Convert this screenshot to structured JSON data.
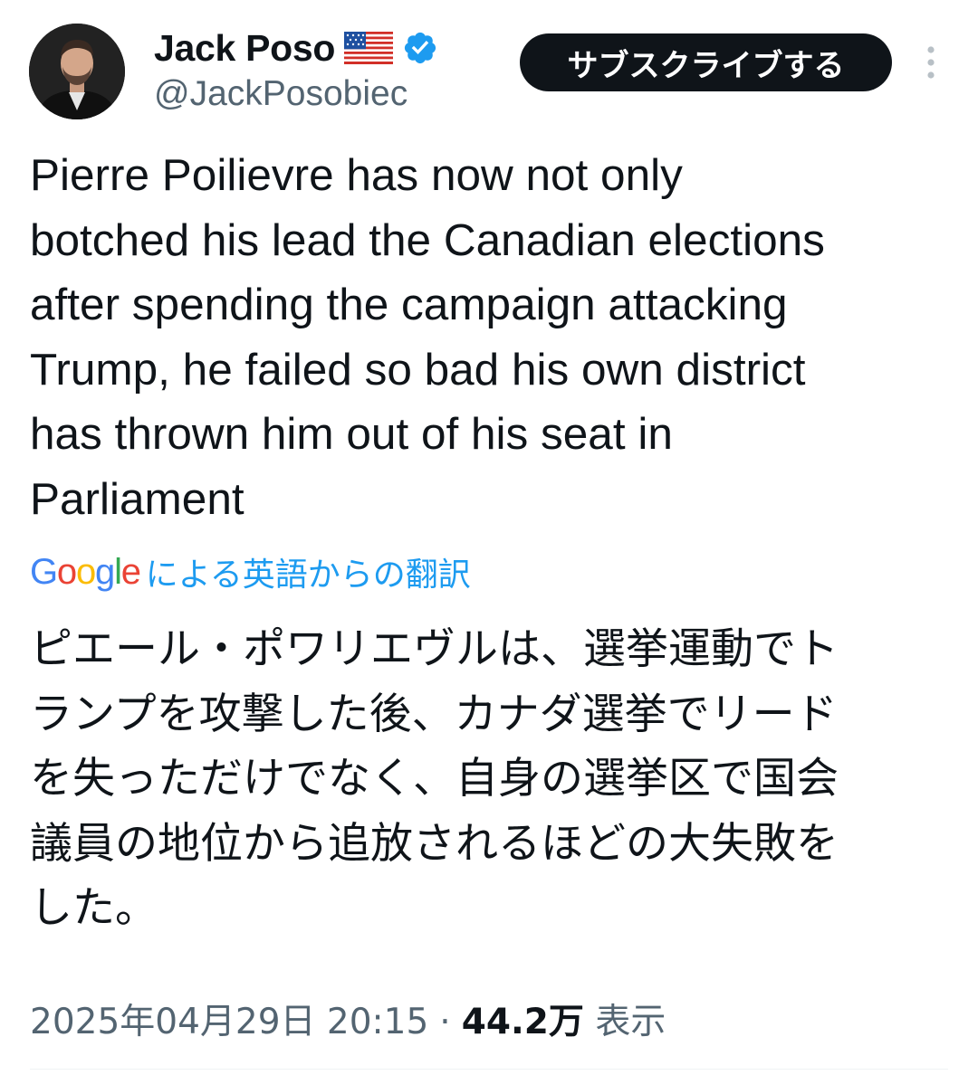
{
  "author": {
    "display_name": "Jack Poso",
    "flag_emoji": "🇺🇸",
    "handle": "@JackPosobiec",
    "verified": true
  },
  "actions": {
    "subscribe_label": "サブスクライブする",
    "more_icon": "more-vertical-icon"
  },
  "tweet": {
    "lines": [
      "Pierre Poilievre has now not only",
      "botched his lead the Canadian elections",
      "after spending the campaign attacking",
      "Trump, he failed so bad his own district",
      "has thrown him out of his seat in",
      "Parliament"
    ]
  },
  "translation": {
    "provider_logo": "Google",
    "attribution": "による英語からの翻訳",
    "lines": [
      "ピエール・ポワリエヴルは、選挙運動でト",
      "ランプを攻撃した後、カナダ選挙でリード",
      "を失っただけでなく、自身の選挙区で国会",
      "議員の地位から追放されるほどの大失敗を",
      "した。"
    ]
  },
  "meta": {
    "timestamp": "2025年04月29日 20:15",
    "separator": "·",
    "views_count": "44.2万",
    "views_label": "表示"
  },
  "colors": {
    "text_primary": "#0f1419",
    "text_secondary": "#536471",
    "link_blue": "#1d9bf0",
    "verified_blue": "#1d9bf0",
    "button_bg": "#0f1419"
  }
}
